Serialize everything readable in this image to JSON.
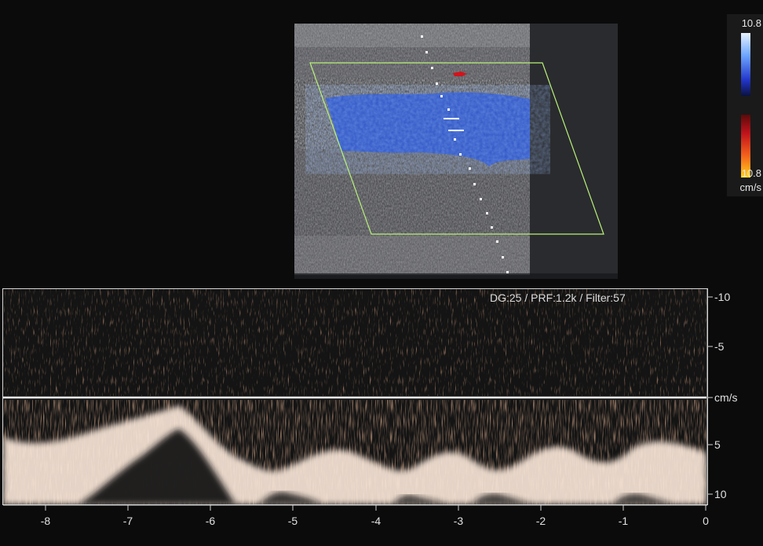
{
  "color_scale": {
    "max_label": "10.8",
    "min_label": "10.8",
    "unit": "cm/s",
    "positive_colors": [
      "#e8f2ff",
      "#2236c9"
    ],
    "negative_colors": [
      "#c0141c",
      "#ffd21a"
    ]
  },
  "doppler": {
    "params_text": "DG:25 /   PRF:1.2k   / Filter:57",
    "velocity_ticks": [
      "-10",
      "-5",
      "cm/s",
      "5",
      "10"
    ],
    "time_ticks": [
      "-8",
      "-7",
      "-6",
      "-5",
      "-4",
      "-3",
      "-2",
      "-1",
      "0"
    ],
    "spectrum_color": "#f2c7a8",
    "baseline_color": "#ffffff"
  },
  "bmode": {
    "roi_box_color": "#b9f27a",
    "flow_color": "#2f56c8"
  }
}
